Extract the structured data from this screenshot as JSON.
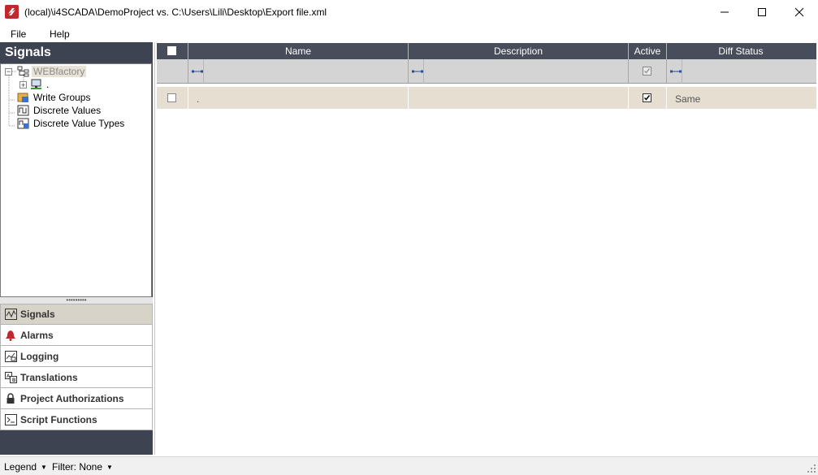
{
  "window": {
    "title": "(local)\\i4SCADA\\DemoProject vs. C:\\Users\\Lili\\Desktop\\Export file.xml",
    "app_icon": "i4scada-logo-icon",
    "accent_color": "#c0282d"
  },
  "menu": {
    "file": "File",
    "help": "Help"
  },
  "left_panel": {
    "header": "Signals",
    "tree": {
      "root": "WEBfactory",
      "child": ".",
      "items": [
        "Write Groups",
        "Discrete Values",
        "Discrete Value Types"
      ]
    },
    "nav": [
      {
        "label": "Signals",
        "icon": "signal-wave-icon",
        "active": true
      },
      {
        "label": "Alarms",
        "icon": "alarm-bell-icon",
        "active": false
      },
      {
        "label": "Logging",
        "icon": "logging-icon",
        "active": false
      },
      {
        "label": "Translations",
        "icon": "translations-icon",
        "active": false
      },
      {
        "label": "Project Authorizations",
        "icon": "lock-icon",
        "active": false
      },
      {
        "label": "Script Functions",
        "icon": "script-icon",
        "active": false
      }
    ]
  },
  "grid": {
    "columns": [
      "Name",
      "Description",
      "Active",
      "Diff Status"
    ],
    "rows": [
      {
        "name": ".",
        "description": "",
        "active": true,
        "diff_status": "Same"
      }
    ]
  },
  "statusbar": {
    "legend": "Legend",
    "filter": "Filter: None"
  },
  "colors": {
    "panel_dark": "#3e4351",
    "grid_header": "#484d5c",
    "row_highlight": "#e6ded0"
  }
}
